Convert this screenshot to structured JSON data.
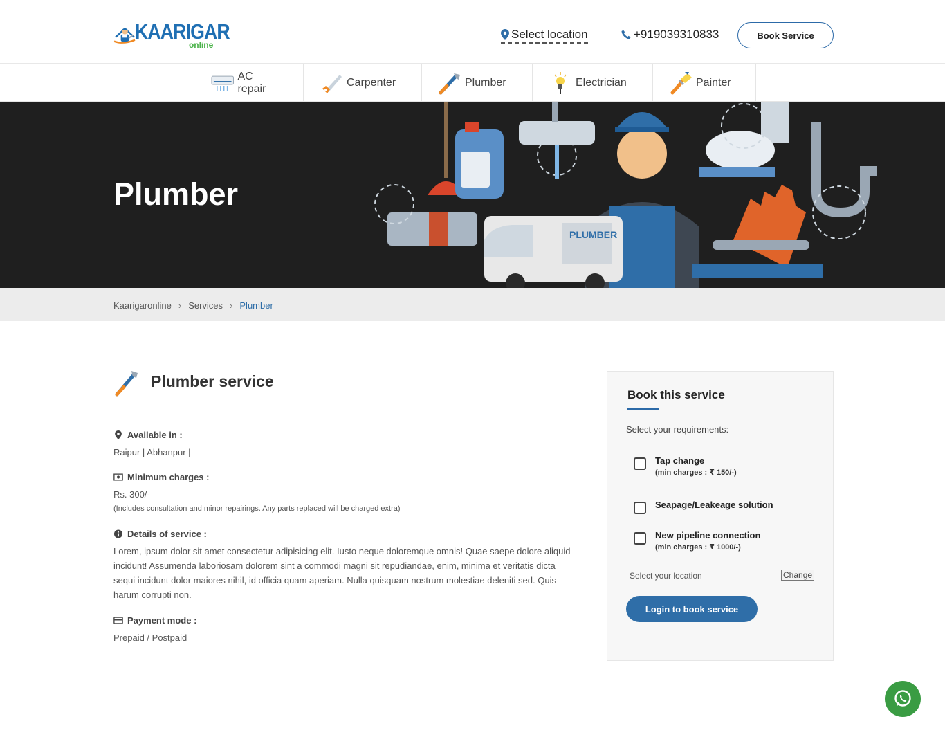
{
  "header": {
    "logo_word": "KAARIGAR",
    "logo_sub": "online",
    "location_label": "Select location",
    "phone": "+919039310833",
    "book_button": "Book Service"
  },
  "nav": {
    "items": [
      {
        "label": "AC repair",
        "icon": "ac-icon"
      },
      {
        "label": "Carpenter",
        "icon": "saw-icon"
      },
      {
        "label": "Plumber",
        "icon": "wrench-icon"
      },
      {
        "label": "Electrician",
        "icon": "bulb-icon"
      },
      {
        "label": "Painter",
        "icon": "brush-icon"
      }
    ]
  },
  "hero": {
    "title": "Plumber",
    "van_label": "PLUMBER"
  },
  "breadcrumb": {
    "items": [
      "Kaarigaronline",
      "Services",
      "Plumber"
    ],
    "separator": "›"
  },
  "service": {
    "title": "Plumber service",
    "available_label": "Available in :",
    "available_value": "Raipur | Abhanpur |",
    "min_charges_label": "Minimum charges :",
    "min_charges_value": "Rs. 300/-",
    "min_charges_note": "(Includes consultation and minor repairings. Any parts replaced will be charged extra)",
    "details_label": "Details of service :",
    "details_value": "Lorem, ipsum dolor sit amet consectetur adipisicing elit. Iusto neque doloremque omnis! Quae saepe dolore aliquid incidunt! Assumenda laboriosam dolorem sint a commodi magni sit repudiandae, enim, minima et veritatis dicta sequi incidunt dolor maiores nihil, id officia quam aperiam. Nulla quisquam nostrum molestiae deleniti sed. Quis harum corrupti non.",
    "payment_label": "Payment mode :",
    "payment_value": "Prepaid / Postpaid"
  },
  "booking": {
    "title": "Book this service",
    "subtitle": "Select your requirements:",
    "requirements": [
      {
        "name": "Tap change",
        "min": "(min charges : ₹ 150/-)"
      },
      {
        "name": "Seapage/Leakeage solution",
        "min": ""
      },
      {
        "name": "New pipeline connection",
        "min": "(min charges : ₹ 1000/-)"
      }
    ],
    "location_text": "Select your location",
    "change_label": "Change",
    "login_button": "Login to book service"
  },
  "colors": {
    "brand_blue": "#2f6ea8",
    "hero_bg": "#1f1f1f",
    "whatsapp": "#3a9c43"
  }
}
